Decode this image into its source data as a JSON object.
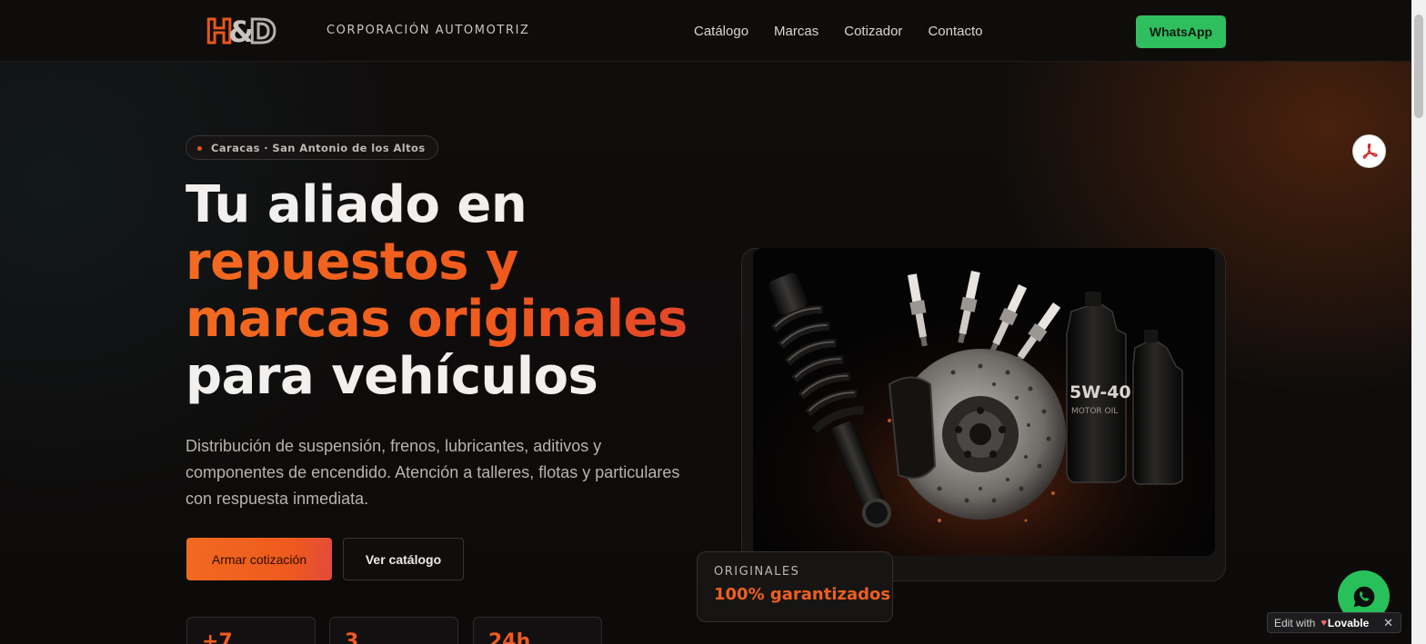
{
  "header": {
    "logo_text": "H&D",
    "brand_name": "CORPORACIÓN AUTOMOTRIZ",
    "nav_items": [
      {
        "label": "Catálogo"
      },
      {
        "label": "Marcas"
      },
      {
        "label": "Cotizador"
      },
      {
        "label": "Contacto"
      }
    ],
    "whatsapp_label": "WhatsApp"
  },
  "hero": {
    "location_pill": "Caracas · San Antonio de los Altos",
    "headline": {
      "line1": "Tu aliado en",
      "line2": "repuestos y",
      "line3": "marcas originales",
      "line4": "para vehículos"
    },
    "description": "Distribución de suspensión, frenos, lubricantes, aditivos y componentes de encendido. Atención a talleres, flotas y particulares con respuesta inmediata.",
    "primary_button": "Armar cotización",
    "secondary_button": "Ver catálogo",
    "stats": [
      {
        "value": "+7"
      },
      {
        "value": "3"
      },
      {
        "value": "24h"
      }
    ]
  },
  "product_image": {
    "oil_label_line1": "5W-40",
    "oil_label_line2": "MOTOR OIL",
    "badge_label": "ORIGINALES",
    "badge_value": "100% garantizados"
  },
  "floating": {
    "lovable_edit": "Edit with",
    "lovable_brand": "Lovable",
    "lovable_close": "✕"
  },
  "colors": {
    "accent": "#ef5a1d",
    "whatsapp": "#2fbf5e",
    "background": "#0c0b0a"
  },
  "icons": [
    "whatsapp-icon",
    "pdf-icon",
    "close-icon",
    "lovable-heart-icon"
  ]
}
